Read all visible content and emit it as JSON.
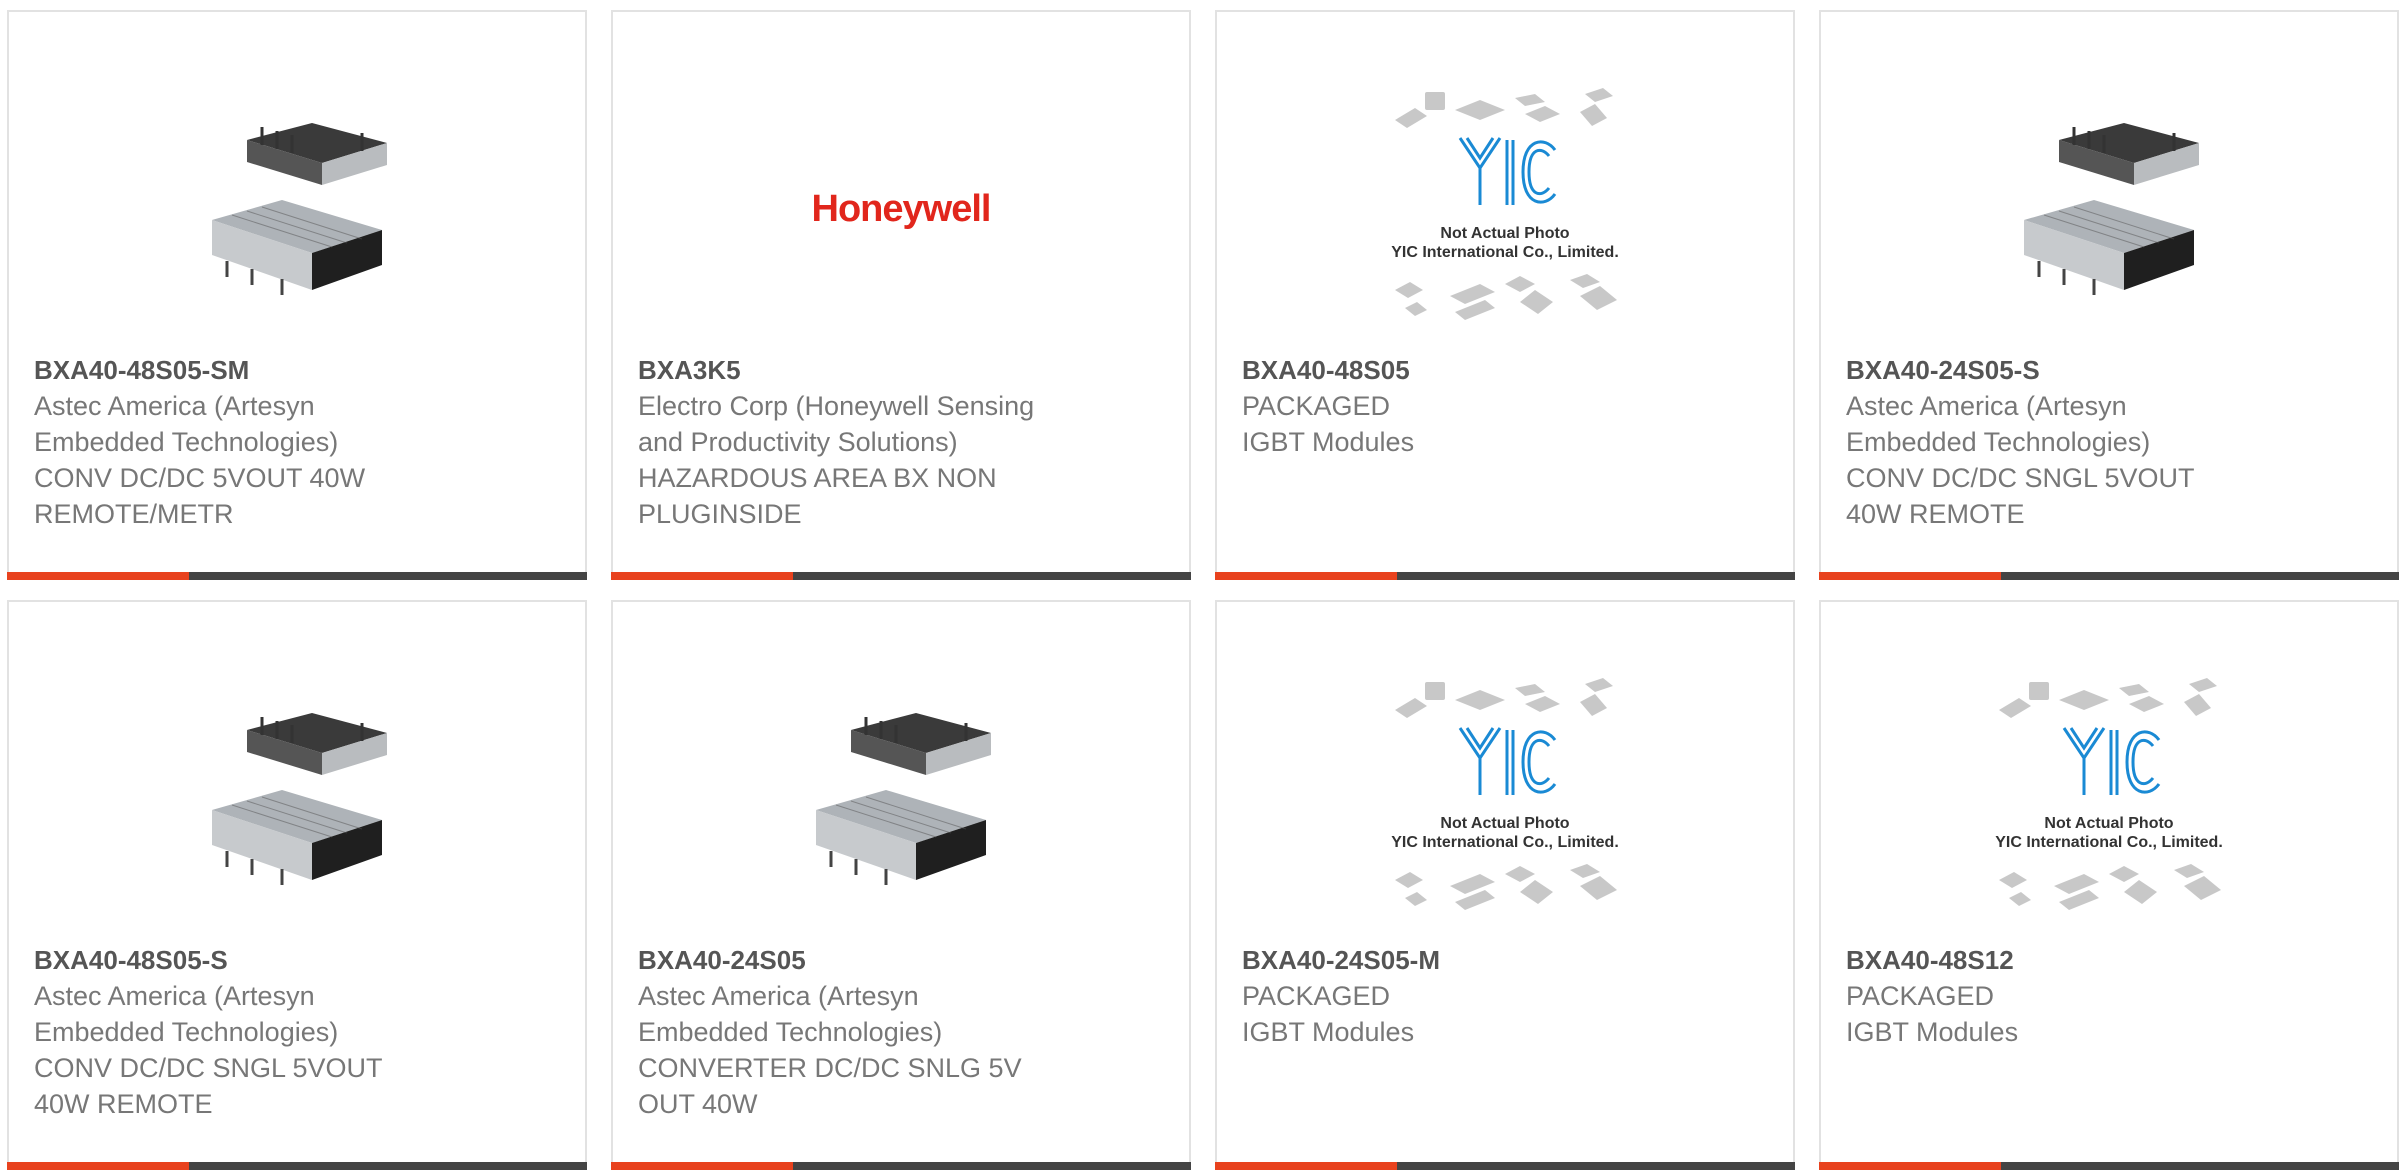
{
  "products": [
    {
      "part": "BXA40-48S05-SM",
      "lines": [
        "Astec America (Artesyn",
        "Embedded Technologies)",
        "CONV DC/DC 5VOUT 40W",
        "REMOTE/METR"
      ],
      "image": "dc-converter-photo"
    },
    {
      "part": "BXA3K5",
      "lines": [
        "Electro Corp (Honeywell Sensing",
        "and Productivity Solutions)",
        "HAZARDOUS AREA BX NON",
        "PLUGINSIDE"
      ],
      "image": "honeywell-logo",
      "logo_text": "Honeywell"
    },
    {
      "part": "BXA40-48S05",
      "lines": [
        "PACKAGED",
        "IGBT Modules"
      ],
      "image": "yic-placeholder",
      "ph1": "Not Actual Photo",
      "ph2": "YIC International Co., Limited."
    },
    {
      "part": "BXA40-24S05-S",
      "lines": [
        "Astec America (Artesyn",
        "Embedded Technologies)",
        "CONV DC/DC SNGL 5VOUT",
        "40W REMOTE"
      ],
      "image": "dc-converter-photo"
    },
    {
      "part": "BXA40-48S05-S",
      "lines": [
        "Astec America (Artesyn",
        "Embedded Technologies)",
        "CONV DC/DC SNGL 5VOUT",
        "40W REMOTE"
      ],
      "image": "dc-converter-photo"
    },
    {
      "part": "BXA40-24S05",
      "lines": [
        "Astec America (Artesyn",
        "Embedded Technologies)",
        "CONVERTER DC/DC SNLG 5V",
        "OUT 40W"
      ],
      "image": "dc-converter-photo"
    },
    {
      "part": "BXA40-24S05-M",
      "lines": [
        "PACKAGED",
        "IGBT Modules"
      ],
      "image": "yic-placeholder",
      "ph1": "Not Actual Photo",
      "ph2": "YIC International Co., Limited."
    },
    {
      "part": "BXA40-48S12",
      "lines": [
        "PACKAGED",
        "IGBT Modules"
      ],
      "image": "yic-placeholder",
      "ph1": "Not Actual Photo",
      "ph2": "YIC International Co., Limited."
    }
  ],
  "colors": {
    "accent": "#e8421e",
    "bar": "#444444",
    "border": "#e2e2e2",
    "yic_blue": "#1a8ad4"
  }
}
